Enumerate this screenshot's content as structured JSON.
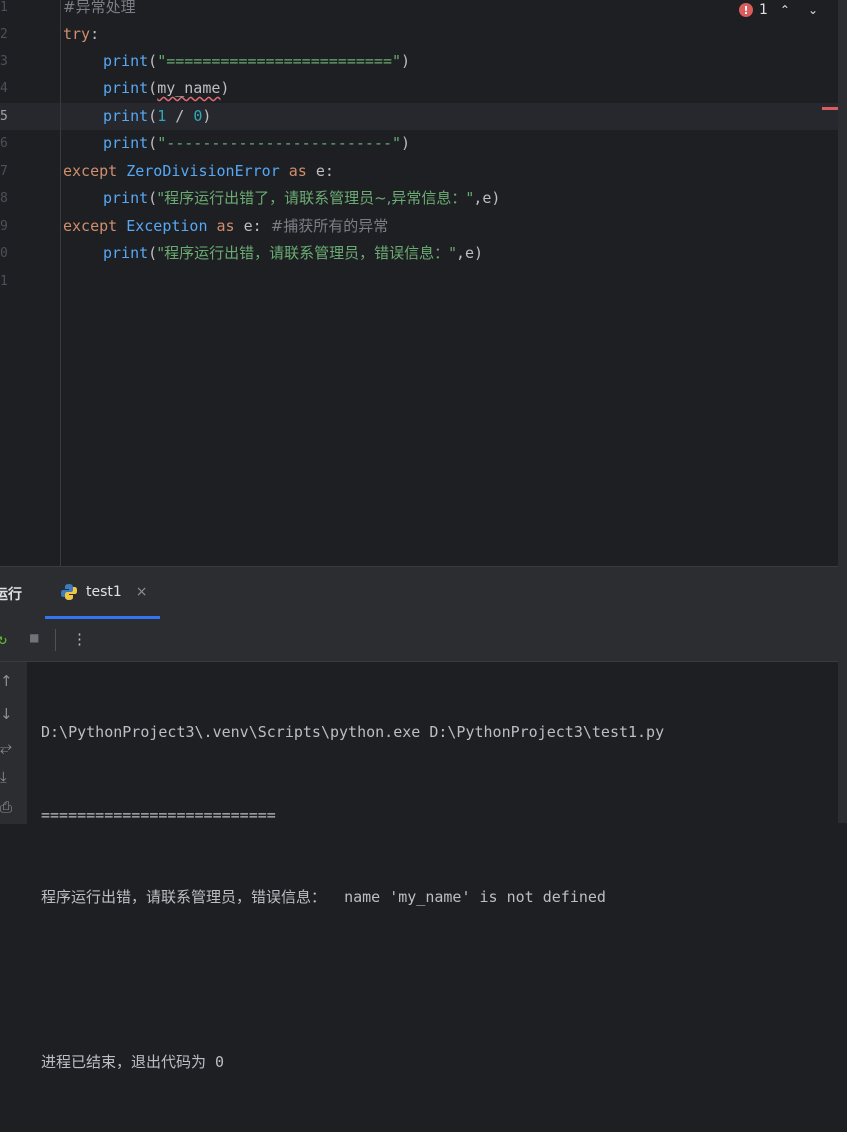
{
  "editor": {
    "line_numbers": [
      "1",
      "2",
      "3",
      "4",
      "5",
      "6",
      "7",
      "8",
      "9",
      "0",
      "1"
    ],
    "lines": [
      {
        "comment": "#异常处理"
      },
      {
        "kw": "try",
        "punct": ":"
      },
      {
        "fn": "print",
        "open": "(",
        "str": "\"=========================\"",
        "close": ")"
      },
      {
        "fn": "print",
        "open": "(",
        "arg": "my_name",
        "close": ")"
      },
      {
        "fn": "print",
        "open": "(",
        "n1": "1",
        "op": " / ",
        "n2": "0",
        "close": ")"
      },
      {
        "fn": "print",
        "open": "(",
        "str": "\"-------------------------\"",
        "close": ")"
      },
      {
        "kw": "except",
        "cls": "ZeroDivisionError",
        "kw2": "as",
        "var": "e:"
      },
      {
        "fn": "print",
        "open": "(",
        "str": "\"程序运行出错了，请联系管理员~,异常信息：\"",
        "tail": ",e)"
      },
      {
        "kw": "except",
        "cls": "Exception",
        "kw2": "as",
        "var": "e:",
        "comment": "#捕获所有的异常"
      },
      {
        "fn": "print",
        "open": "(",
        "str": "\"程序运行出错，请联系管理员，错误信息：\"",
        "tail": ",e)"
      }
    ],
    "inspection": {
      "error_count": "1",
      "up": "⌃",
      "down": "⌄"
    }
  },
  "run_panel": {
    "label": "运行",
    "tab_label": "test1",
    "tab_close": "×",
    "toolbar": {
      "rerun": "↻",
      "stop": "■",
      "more": "⋮"
    },
    "sidebar": [
      "↑",
      "↓",
      "⥂",
      "⤓",
      "⎙"
    ],
    "output": [
      "D:\\PythonProject3\\.venv\\Scripts\\python.exe D:\\PythonProject3\\test1.py",
      "==========================",
      "程序运行出错，请联系管理员，错误信息：  name 'my_name' is not defined",
      "",
      "进程已结束，退出代码为 0"
    ]
  },
  "colors": {
    "background": "#1e1f22",
    "panel": "#2b2d30",
    "accent": "#3574f0",
    "error": "#db5c5c"
  }
}
